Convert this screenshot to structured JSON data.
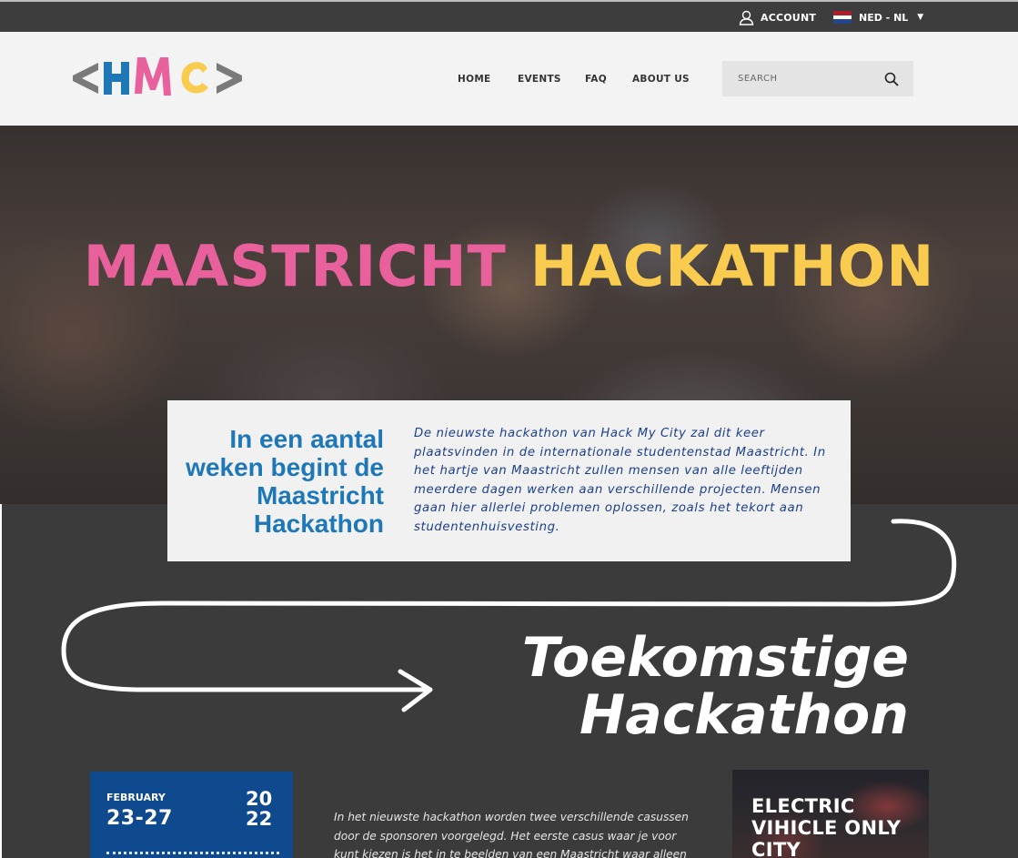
{
  "topbar": {
    "account_label": "ACCOUNT",
    "language_label": "NED - NL",
    "flag_colors": [
      "#ae1c28",
      "#ffffff",
      "#21468b"
    ]
  },
  "header": {
    "logo_letters": "HMC",
    "nav": [
      "HOME",
      "EVENTS",
      "FAQ",
      "ABOUT US"
    ],
    "search_placeholder": "SEARCH"
  },
  "hero": {
    "title_part1": "MAASTRICHT",
    "title_part2": "HACKATHON"
  },
  "intro_card": {
    "heading": "In een aantal weken begint de Maastricht Hackathon",
    "text": "De nieuwste hackathon van Hack My City zal dit keer plaatsvinden in de internationale studentenstad Maastricht. In het hartje van Maastricht zullen mensen van alle leeftijden meerdere dagen werken aan verschillende projecten. Mensen gaan hier allerlei problemen oplossen, zoals het tekort aan studentenhuisvesting."
  },
  "upcoming": {
    "title_line1": "Toekomstige",
    "title_line2": "Hackathon"
  },
  "event": {
    "month": "FEBRUARY",
    "days": "23-27",
    "year_top": "20",
    "year_bottom": "22",
    "description": "In het nieuwste hackathon worden twee verschillende casussen door de sponsoren voorgelegd. Het eerste casus waar je voor kunt kiezen is het in te beelden van een Maastricht waar alleen elektrische"
  },
  "city_card": {
    "title": "ELECTRIC VIHICLE ONLY CITY"
  },
  "colors": {
    "pink": "#e8609c",
    "yellow": "#f9cc4f",
    "blue": "#1e78b8",
    "navy": "#0f4a8e",
    "dark": "#3b3b3b"
  }
}
